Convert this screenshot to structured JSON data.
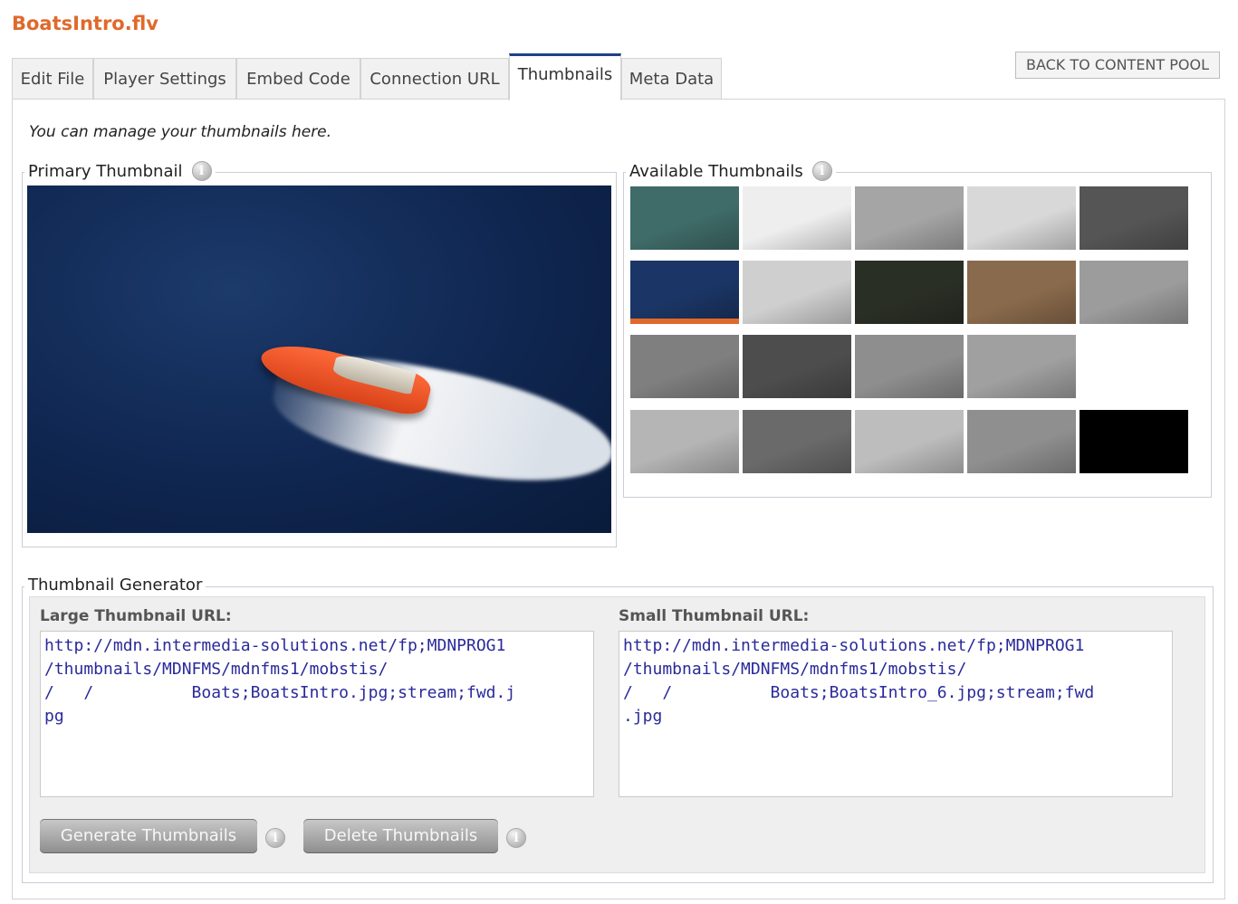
{
  "file": {
    "title": "BoatsIntro.flv"
  },
  "back_button": "BACK TO CONTENT POOL",
  "tabs": [
    {
      "label": "Edit File"
    },
    {
      "label": "Player Settings"
    },
    {
      "label": "Embed Code"
    },
    {
      "label": "Connection URL"
    },
    {
      "label": "Thumbnails",
      "active": true
    },
    {
      "label": "Meta Data"
    }
  ],
  "intro": "You can manage your thumbnails here.",
  "primary": {
    "legend": "Primary Thumbnail"
  },
  "available": {
    "legend": "Available Thumbnails",
    "thumbnails": [
      {
        "tone": "#3f6b68"
      },
      {
        "tone": "#eeeeee"
      },
      {
        "tone": "#a5a5a5"
      },
      {
        "tone": "#d8d8d8"
      },
      {
        "tone": "#555555"
      },
      {
        "tone": "#1b3666",
        "selected": true
      },
      {
        "tone": "#cfcfcf"
      },
      {
        "tone": "#2a2f26"
      },
      {
        "tone": "#8a6a4c"
      },
      {
        "tone": "#9c9c9c"
      },
      {
        "tone": "#7f7f7f"
      },
      {
        "tone": "#4d4d4d"
      },
      {
        "tone": "#8e8e8e"
      },
      {
        "tone": "#a0a0a0"
      },
      {
        "tone": "#ffffff"
      },
      {
        "tone": "#b5b5b5"
      },
      {
        "tone": "#6a6a6a"
      },
      {
        "tone": "#bdbdbd"
      },
      {
        "tone": "#8f8f8f"
      },
      {
        "tone": "#000000"
      }
    ]
  },
  "generator": {
    "legend": "Thumbnail Generator",
    "large_label": "Large Thumbnail URL:",
    "large_url": "http://mdn.intermedia-solutions.net/fp;MDNPROG1\n/thumbnails/MDNFMS/mdnfms1/mobstis/\n/   /          Boats;BoatsIntro.jpg;stream;fwd.j\npg",
    "small_label": "Small Thumbnail URL:",
    "small_url": "http://mdn.intermedia-solutions.net/fp;MDNPROG1\n/thumbnails/MDNFMS/mdnfms1/mobstis/\n/   /          Boats;BoatsIntro_6.jpg;stream;fwd\n.jpg",
    "generate_button": "Generate Thumbnails",
    "delete_button": "Delete Thumbnails"
  },
  "colors": {
    "title": "#e0692b",
    "active_tab": "#1f3f8a",
    "selected_thumb": "#e0692b"
  }
}
